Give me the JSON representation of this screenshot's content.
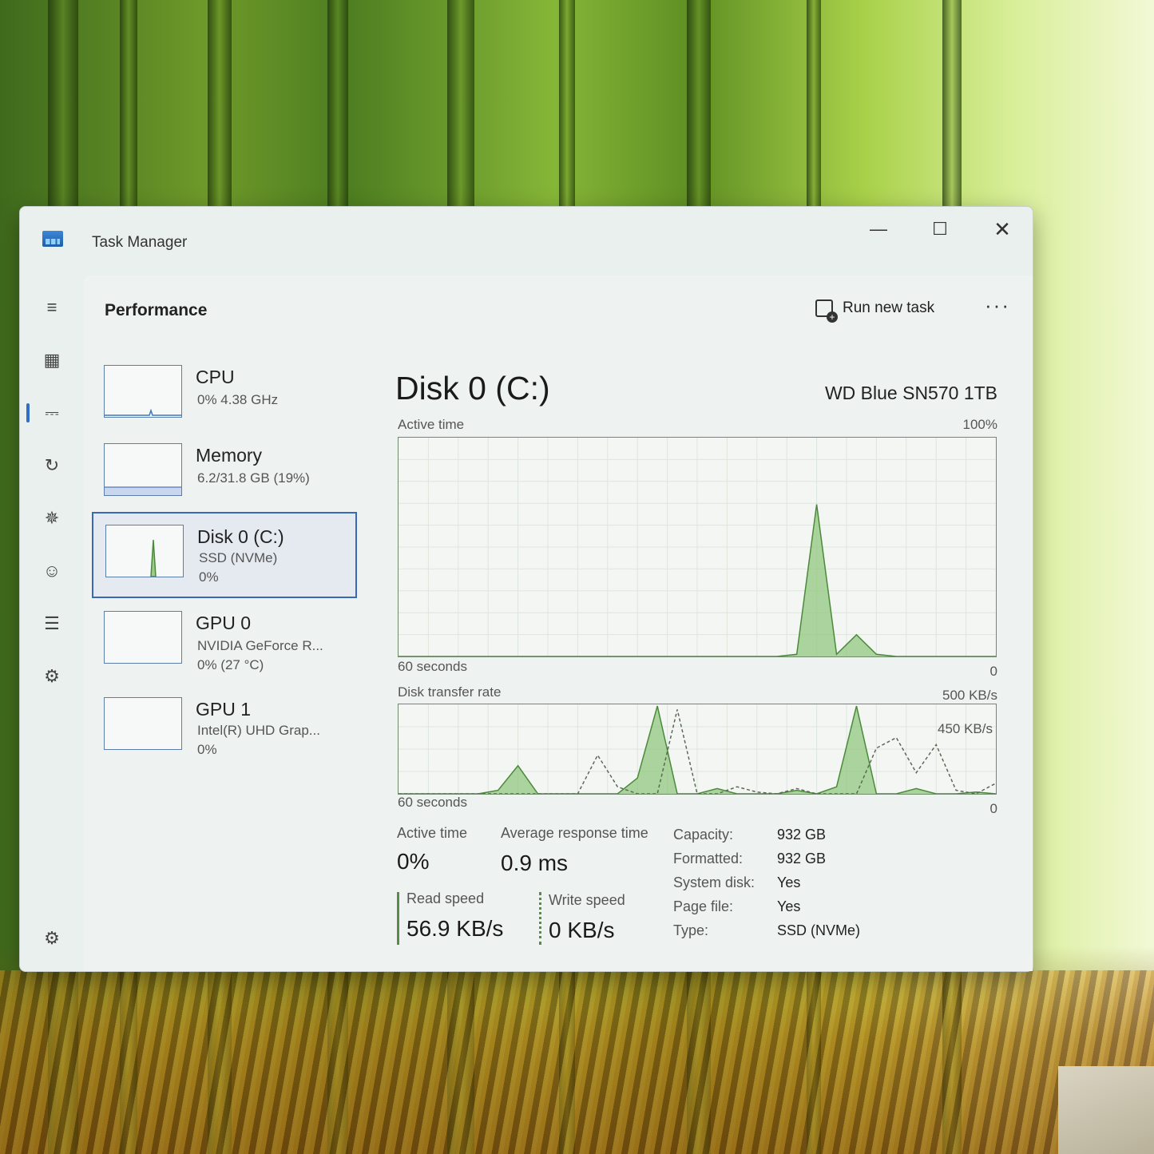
{
  "window": {
    "title": "Task Manager"
  },
  "titlebar": {
    "minimize": "—",
    "maximize": "☐",
    "close": "✕"
  },
  "rail": [
    {
      "icon": "hamburger-menu-icon",
      "glyph": "≡"
    },
    {
      "icon": "processes-icon",
      "glyph": "▦"
    },
    {
      "icon": "performance-icon",
      "glyph": "⎓"
    },
    {
      "icon": "app-history-icon",
      "glyph": "↻"
    },
    {
      "icon": "startup-apps-icon",
      "glyph": "✵"
    },
    {
      "icon": "users-icon",
      "glyph": "☺"
    },
    {
      "icon": "details-icon",
      "glyph": "☰"
    },
    {
      "icon": "services-icon",
      "glyph": "⚙"
    }
  ],
  "settings_glyph": "⚙",
  "header": {
    "title": "Performance",
    "run_task": "Run new task",
    "more": "···"
  },
  "perf_list": [
    {
      "name": "CPU",
      "line1": "0% 4.38 GHz",
      "line2": ""
    },
    {
      "name": "Memory",
      "line1": "6.2/31.8 GB (19%)",
      "line2": ""
    },
    {
      "name": "Disk 0 (C:)",
      "line1": "SSD (NVMe)",
      "line2": "0%"
    },
    {
      "name": "GPU 0",
      "line1": "NVIDIA GeForce R...",
      "line2": "0% (27 °C)"
    },
    {
      "name": "GPU 1",
      "line1": "Intel(R) UHD Grap...",
      "line2": "0%"
    }
  ],
  "detail": {
    "title": "Disk 0 (C:)",
    "model": "WD Blue SN570 1TB",
    "active_label": "Active time",
    "active_max": "100%",
    "active_span": "60 seconds",
    "active_min": "0",
    "transfer_label": "Disk transfer rate",
    "transfer_max": "500 KB/s",
    "transfer_mark": "450 KB/s",
    "transfer_span": "60 seconds",
    "transfer_min": "0",
    "stats": {
      "active_time_label": "Active time",
      "active_time_value": "0%",
      "avg_resp_label": "Average response time",
      "avg_resp_value": "0.9 ms",
      "read_label": "Read speed",
      "read_value": "56.9 KB/s",
      "write_label": "Write speed",
      "write_value": "0 KB/s"
    },
    "properties": [
      {
        "key": "Capacity:",
        "value": "932 GB"
      },
      {
        "key": "Formatted:",
        "value": "932 GB"
      },
      {
        "key": "System disk:",
        "value": "Yes"
      },
      {
        "key": "Page file:",
        "value": "Yes"
      },
      {
        "key": "Type:",
        "value": "SSD (NVMe)"
      }
    ]
  },
  "chart_data": [
    {
      "type": "area",
      "title": "Active time",
      "ylim": [
        0,
        100
      ],
      "x": [
        0,
        5,
        10,
        15,
        20,
        25,
        30,
        35,
        38,
        40,
        42,
        44,
        46,
        48,
        50,
        55,
        60
      ],
      "values": [
        0,
        0,
        0,
        0,
        0,
        0,
        0,
        0,
        0,
        1,
        70,
        1,
        10,
        1,
        0,
        0,
        0
      ]
    },
    {
      "type": "area",
      "title": "Disk transfer rate",
      "ylim": [
        0,
        500
      ],
      "x": [
        0,
        5,
        8,
        10,
        12,
        14,
        15,
        18,
        20,
        22,
        24,
        26,
        28,
        30,
        32,
        34,
        36,
        38,
        40,
        42,
        44,
        46,
        48,
        50,
        52,
        54,
        56,
        58,
        60
      ],
      "series": [
        {
          "values": [
            0,
            0,
            0,
            20,
            160,
            0,
            0,
            0,
            0,
            0,
            90,
            500,
            0,
            0,
            30,
            0,
            0,
            0,
            20,
            0,
            40,
            520,
            0,
            0,
            30,
            0,
            0,
            10,
            0
          ]
        },
        {
          "values": [
            0,
            0,
            0,
            0,
            0,
            0,
            0,
            0,
            220,
            40,
            0,
            0,
            480,
            0,
            0,
            40,
            10,
            0,
            30,
            0,
            0,
            0,
            260,
            320,
            120,
            280,
            20,
            0,
            60
          ]
        }
      ]
    }
  ]
}
